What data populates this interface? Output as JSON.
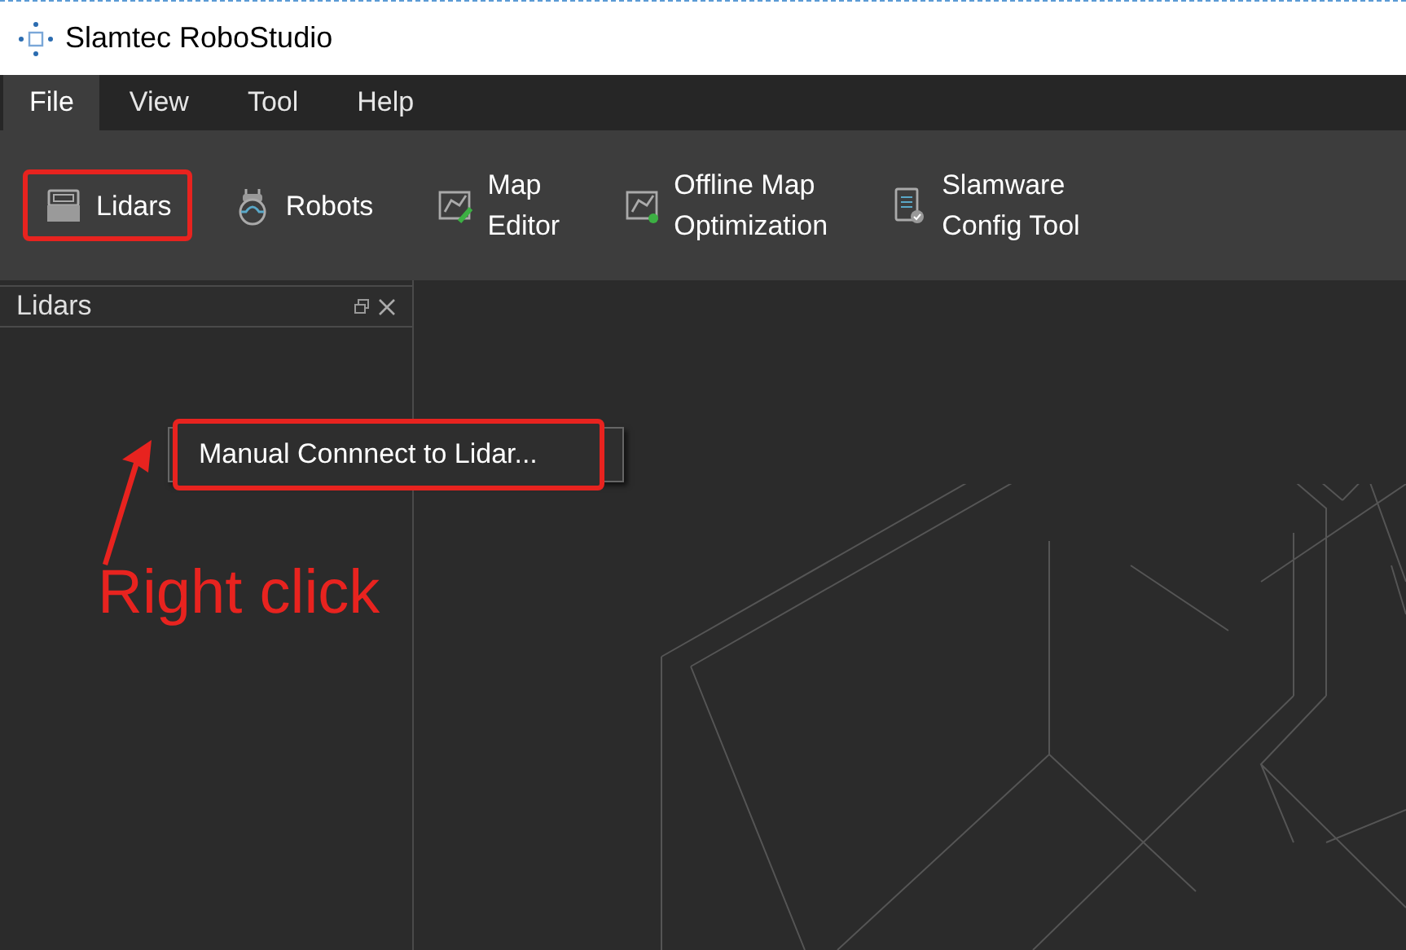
{
  "window": {
    "title": "Slamtec RoboStudio"
  },
  "menu": [
    {
      "label": "File",
      "selected": true
    },
    {
      "label": "View",
      "selected": false
    },
    {
      "label": "Tool",
      "selected": false
    },
    {
      "label": "Help",
      "selected": false
    }
  ],
  "ribbon": [
    {
      "kind": "lidar",
      "lines": [
        "Lidars"
      ],
      "highlighted": true
    },
    {
      "kind": "robot",
      "lines": [
        "Robots"
      ],
      "highlighted": false
    },
    {
      "kind": "map-edit",
      "lines": [
        "Map",
        "Editor"
      ],
      "highlighted": false
    },
    {
      "kind": "map-optimize",
      "lines": [
        "Offline Map",
        "Optimization"
      ],
      "highlighted": false
    },
    {
      "kind": "config",
      "lines": [
        "Slamware",
        "Config Tool"
      ],
      "highlighted": false
    }
  ],
  "panel": {
    "title": "Lidars"
  },
  "context_menu": {
    "items": [
      {
        "label": "Manual Connnect to Lidar...",
        "highlighted": true
      }
    ]
  },
  "annotation": {
    "text": "Right click"
  }
}
